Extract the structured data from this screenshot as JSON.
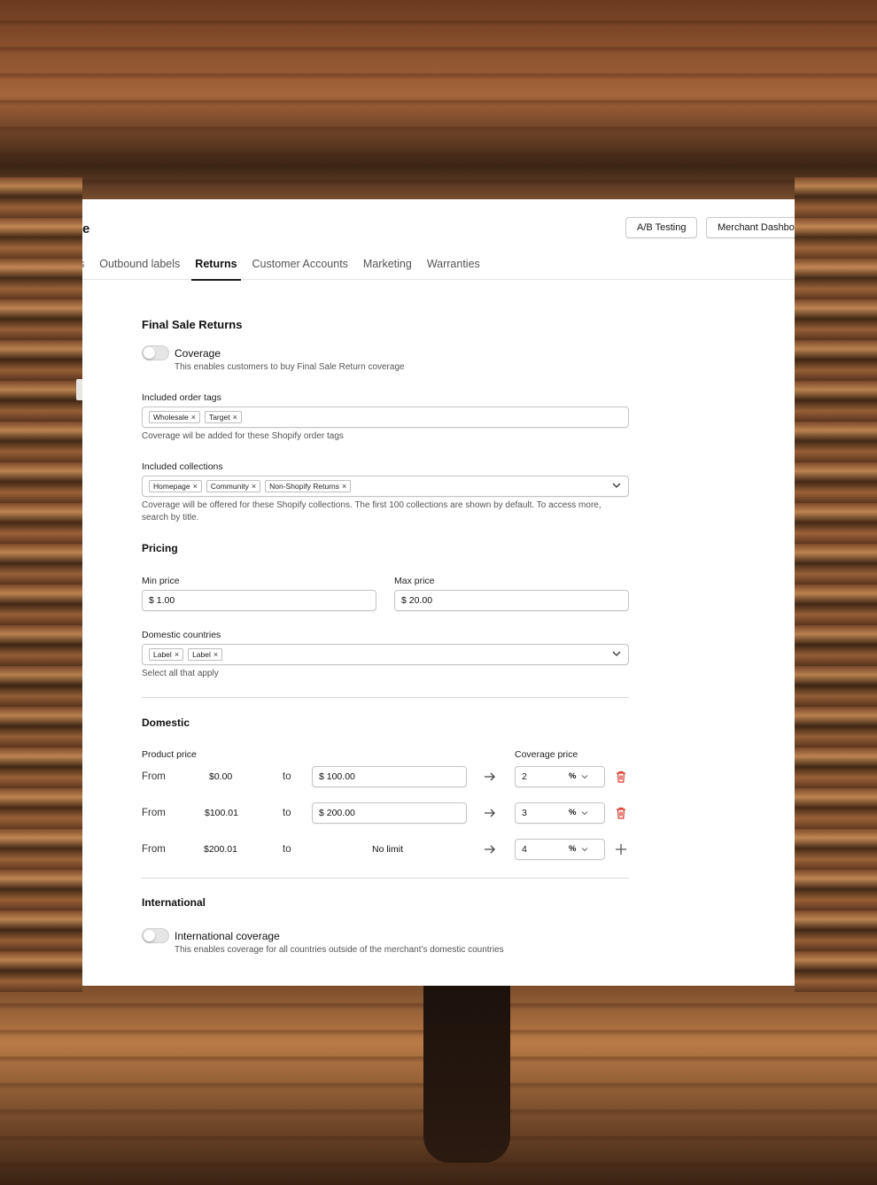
{
  "header": {
    "title_fragment": "e",
    "ab_testing_label": "A/B Testing",
    "merchant_dashboard_label": "Merchant Dashboard"
  },
  "tabs": [
    {
      "label": "s"
    },
    {
      "label": "Outbound labels"
    },
    {
      "label": "Returns",
      "active": true
    },
    {
      "label": "Customer Accounts"
    },
    {
      "label": "Marketing"
    },
    {
      "label": "Warranties"
    }
  ],
  "final_sale": {
    "heading": "Final Sale Returns",
    "coverage_toggle": {
      "title": "Coverage",
      "description": "This enables customers to buy Final Sale Return coverage",
      "enabled": false
    },
    "order_tags": {
      "label": "Included order tags",
      "tags": [
        "Wholesale",
        "Target"
      ],
      "help": "Coverage wil be added for these Shopify order tags"
    },
    "collections": {
      "label": "Included collections",
      "tags": [
        "Homepage",
        "Community",
        "Non-Shopify Returns"
      ],
      "help": "Coverage will be offered for these Shopify collections. The first 100 collections are shown by default. To access more, search by title."
    }
  },
  "pricing": {
    "heading": "Pricing",
    "min_price": {
      "label": "Min price",
      "value": "$ 1.00"
    },
    "max_price": {
      "label": "Max price",
      "value": "$ 20.00"
    },
    "domestic_countries": {
      "label": "Domestic countries",
      "tags": [
        "Label",
        "Label"
      ],
      "help": "Select all that apply"
    }
  },
  "domestic": {
    "heading": "Domestic",
    "product_price_label": "Product price",
    "coverage_price_label": "Coverage price",
    "from_label": "From",
    "to_label": "to",
    "rows": [
      {
        "from": "$0.00",
        "to": "$ 100.00",
        "coverage": "2",
        "unit": "%"
      },
      {
        "from": "$100.01",
        "to": "$ 200.00",
        "coverage": "3",
        "unit": "%"
      },
      {
        "from": "$200.01",
        "to": "No limit",
        "coverage": "4",
        "unit": "%"
      }
    ]
  },
  "international": {
    "heading": "International",
    "toggle": {
      "title": "International coverage",
      "description": "This enables coverage for all countries outside of the merchant’s domestic countries",
      "enabled": false
    }
  },
  "colors": {
    "delete_icon": "#d9342b",
    "border": "#c4c4c4",
    "active_tab_underline": "#1a1a1a"
  },
  "icons": [
    "chevron-down-icon",
    "arrow-right-icon",
    "trash-icon",
    "plus-icon",
    "close-icon"
  ]
}
